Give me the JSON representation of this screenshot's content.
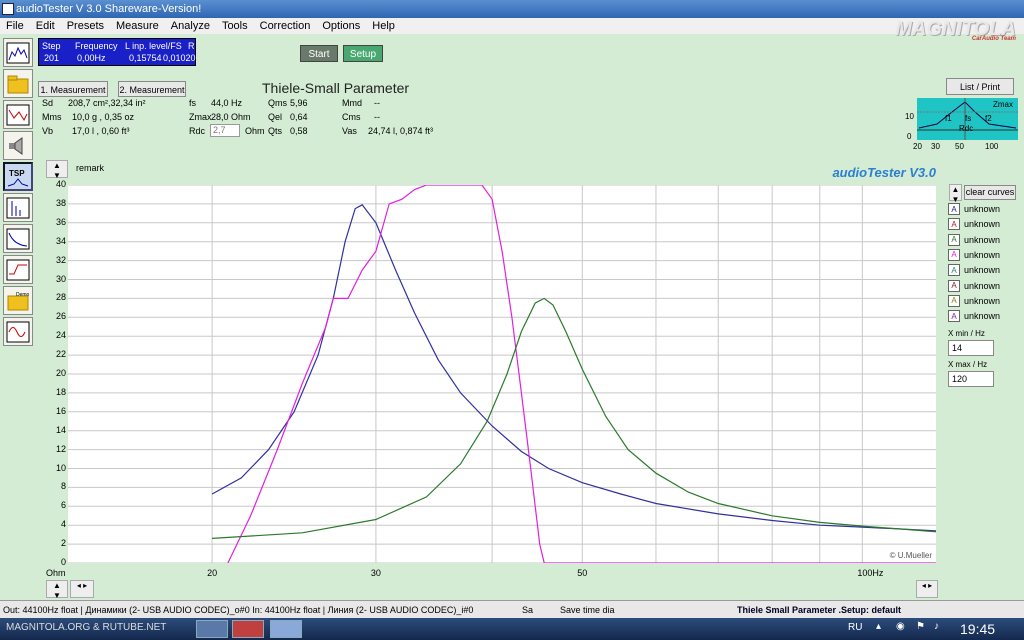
{
  "window": {
    "title": "audioTester  V 3.0 Shareware-Version!"
  },
  "menu": [
    "File",
    "Edit",
    "Presets",
    "Measure",
    "Analyze",
    "Tools",
    "Correction",
    "Options",
    "Help"
  ],
  "brand": {
    "name": "MAGNITOLA",
    "sub": "CarAudio Team"
  },
  "stepbox": {
    "h_step": "Step",
    "h_freq": "Frequency",
    "h_level": "L inp. level/FS",
    "h_r": "R",
    "step": "201",
    "freq": "0,00Hz",
    "level": "0,15754",
    "r": "0,01020"
  },
  "buttons": {
    "start": "Start",
    "setup": "Setup",
    "meas1": "1. Measurement",
    "meas2": "2. Measurement",
    "list_print": "List / Print",
    "clear_curves": "clear curves"
  },
  "tsp": {
    "title": "Thiele-Small Parameter",
    "sd_l": "Sd",
    "sd_v": "208,7  cm²,32,34  in²",
    "mms_l": "Mms",
    "mms_v": "10,0  g    ,  0,35  oz",
    "vb_l": "Vb",
    "vb_v": "17,0  l    ,  0,60  ft³",
    "fs_l": "fs",
    "fs_v": "44,0 Hz",
    "zmax_l": "Zmax",
    "zmax_v": "28,0 Ohm",
    "rdc_l": "Rdc",
    "rdc_v": "2,7",
    "rdc_u": "Ohm",
    "qms_l": "Qms",
    "qms_v": "5,96",
    "qel_l": "Qel",
    "qel_v": "0,64",
    "qts_l": "Qts",
    "qts_v": "0,58",
    "mmd_l": "Mmd",
    "mmd_v": "--",
    "cms_l": "Cms",
    "cms_v": "--",
    "vas_l": "Vas",
    "vas_v": "24,74 l, 0,874 ft³"
  },
  "minigraph": {
    "zmax": "Zmax",
    "fs": "fs",
    "f1": "f1",
    "f2": "f2",
    "rdc": "Rdc",
    "y10": "10",
    "y0": "0",
    "x20": "20",
    "x30": "30",
    "x50": "50",
    "x100": "100"
  },
  "chart_header": {
    "remark": "remark",
    "app_title": "audioTester  V3.0",
    "credit": "© U.Mueller",
    "ylabel": "Ohm"
  },
  "legend": {
    "items": [
      "unknown",
      "unknown",
      "unknown",
      "unknown",
      "unknown",
      "unknown",
      "unknown",
      "unknown"
    ],
    "colors": [
      "#2020a0",
      "#b02020",
      "#208020",
      "#e020e0",
      "#208080",
      "#802020",
      "#808020",
      "#8020a0"
    ],
    "swatch_glyph": "A",
    "xmin_label": "X min / Hz",
    "xmin_value": "14",
    "xmax_label": "X max / Hz",
    "xmax_value": "120"
  },
  "status": {
    "left": "Out: 44100Hz float  | Динамики (2- USB AUDIO  CODEC)_o#0  In: 44100Hz float  | Линия (2- USB AUDIO  CODEC)_i#0",
    "sa": "Sa",
    "save": "Save time dia",
    "right": "Thiele Small Parameter .Setup:  default"
  },
  "taskbar": {
    "watermark": "MAGNITOLA.ORG & RUTUBE.NET",
    "lang": "RU",
    "time": "19:45"
  },
  "chart_data": {
    "type": "line",
    "ylabel": "Ohm",
    "xlabel": "",
    "xscale": "log",
    "xlim": [
      14,
      120
    ],
    "ylim": [
      0,
      40
    ],
    "x_ticks": [
      20,
      30,
      50,
      100
    ],
    "x_tick_labels": [
      "20",
      "30",
      "50",
      "100Hz"
    ],
    "y_ticks": [
      0,
      2,
      4,
      6,
      8,
      10,
      12,
      14,
      16,
      18,
      20,
      22,
      24,
      26,
      28,
      30,
      32,
      34,
      36,
      38,
      40
    ],
    "grid": true,
    "series": [
      {
        "color": "#3030a0",
        "points": [
          [
            20,
            7.3
          ],
          [
            21.5,
            9
          ],
          [
            23,
            12
          ],
          [
            24.5,
            16
          ],
          [
            26,
            22
          ],
          [
            27,
            28
          ],
          [
            27.8,
            34
          ],
          [
            28.5,
            37.5
          ],
          [
            29,
            37.9
          ],
          [
            30,
            36
          ],
          [
            31.5,
            31
          ],
          [
            33,
            26.5
          ],
          [
            35,
            21.5
          ],
          [
            37,
            18
          ],
          [
            40,
            14.5
          ],
          [
            43,
            11.8
          ],
          [
            46,
            10
          ],
          [
            50,
            8.5
          ],
          [
            55,
            7.3
          ],
          [
            60,
            6.3
          ],
          [
            70,
            5.2
          ],
          [
            80,
            4.5
          ],
          [
            90,
            4
          ],
          [
            100,
            3.8
          ],
          [
            110,
            3.6
          ],
          [
            120,
            3.4
          ]
        ]
      },
      {
        "color": "#e020e0",
        "points": [
          [
            20.8,
            0
          ],
          [
            22,
            5
          ],
          [
            23.5,
            12
          ],
          [
            25,
            19
          ],
          [
            26.5,
            25
          ],
          [
            27,
            28
          ],
          [
            28,
            28
          ],
          [
            29,
            31
          ],
          [
            30,
            33
          ],
          [
            31,
            38
          ],
          [
            32,
            38.5
          ],
          [
            33,
            39.5
          ],
          [
            34,
            40
          ],
          [
            37,
            40
          ],
          [
            39,
            40
          ],
          [
            40,
            38.5
          ],
          [
            41,
            33
          ],
          [
            42,
            26
          ],
          [
            43,
            18
          ],
          [
            44,
            10
          ],
          [
            45,
            2
          ],
          [
            45.5,
            0
          ],
          [
            60,
            0
          ],
          [
            120,
            0
          ]
        ]
      },
      {
        "color": "#2a7a2a",
        "points": [
          [
            20,
            2.6
          ],
          [
            25,
            3.2
          ],
          [
            30,
            4.6
          ],
          [
            34,
            7
          ],
          [
            37,
            10.5
          ],
          [
            39.5,
            15
          ],
          [
            41.5,
            20
          ],
          [
            43,
            24.5
          ],
          [
            44.5,
            27.5
          ],
          [
            45.5,
            28
          ],
          [
            46.5,
            27.3
          ],
          [
            48,
            24.5
          ],
          [
            50,
            20.5
          ],
          [
            53,
            15.5
          ],
          [
            56,
            12
          ],
          [
            60,
            9.5
          ],
          [
            65,
            7.5
          ],
          [
            70,
            6.3
          ],
          [
            80,
            5
          ],
          [
            90,
            4.3
          ],
          [
            100,
            3.9
          ],
          [
            110,
            3.6
          ],
          [
            120,
            3.3
          ]
        ]
      }
    ]
  }
}
